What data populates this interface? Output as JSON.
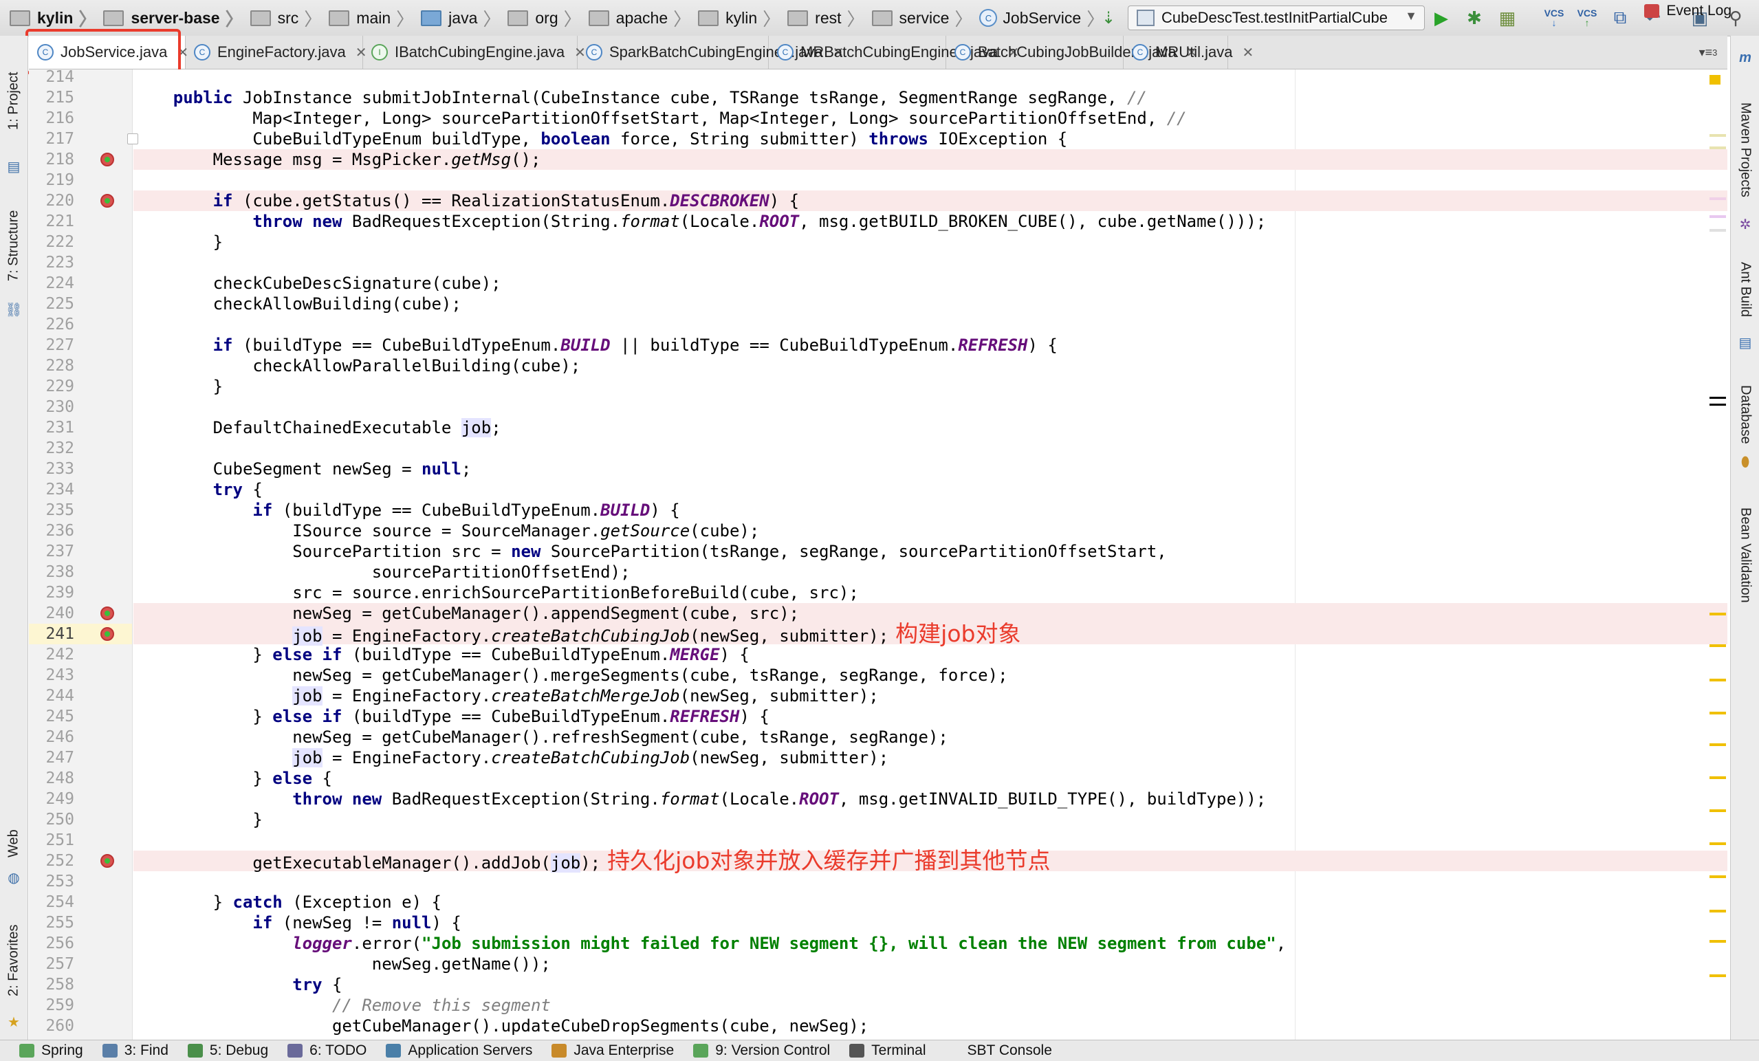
{
  "breadcrumbs": [
    "kylin",
    "server-base",
    "src",
    "main",
    "java",
    "org",
    "apache",
    "kylin",
    "rest",
    "service",
    "JobService"
  ],
  "run_config": "CubeDescTest.testInitPartialCube",
  "toolbar": {
    "vcs1": "VCS",
    "vcs2": "VCS",
    "tab_overflow": "3"
  },
  "tabs": [
    {
      "label": "JobService.java",
      "kind": "C"
    },
    {
      "label": "EngineFactory.java",
      "kind": "C"
    },
    {
      "label": "IBatchCubingEngine.java",
      "kind": "I"
    },
    {
      "label": "SparkBatchCubingEngine2.java",
      "kind": "C"
    },
    {
      "label": "MRBatchCubingEngine2.java",
      "kind": "C"
    },
    {
      "label": "BatchCubingJobBuilder2.java",
      "kind": "C"
    },
    {
      "label": "MRUtil.java",
      "kind": "C"
    }
  ],
  "left_tools": [
    "1: Project",
    "7: Structure",
    "Web",
    "2: Favorites"
  ],
  "right_tools": [
    "Maven Projects",
    "Ant Build",
    "Database",
    "Bean Validation"
  ],
  "bottom_tools": [
    "Spring",
    "3: Find",
    "5: Debug",
    "6: TODO",
    "Application Servers",
    "Java Enterprise",
    "9: Version Control",
    "Terminal",
    "SBT Console"
  ],
  "event_log": "Event Log",
  "annotations": {
    "create_job": "构建job对象",
    "persist_job": "持久化job对象并放入缓存并广播到其他节点"
  },
  "colors": {
    "annotation": "#ea3b2c",
    "keyword": "#000080",
    "string": "#008000",
    "breakpoint_line": "#fae9e9"
  },
  "editor": {
    "first_line": 214,
    "current_line": 241,
    "breakpoint_lines": [
      218,
      220,
      240,
      241,
      252
    ],
    "lines": [
      "",
      "    public JobInstance submitJobInternal(CubeInstance cube, TSRange tsRange, SegmentRange segRange, //",
      "            Map<Integer, Long> sourcePartitionOffsetStart, Map<Integer, Long> sourcePartitionOffsetEnd, //",
      "            CubeBuildTypeEnum buildType, boolean force, String submitter) throws IOException {",
      "        Message msg = MsgPicker.getMsg();",
      "",
      "        if (cube.getStatus() == RealizationStatusEnum.DESCBROKEN) {",
      "            throw new BadRequestException(String.format(Locale.ROOT, msg.getBUILD_BROKEN_CUBE(), cube.getName()));",
      "        }",
      "",
      "        checkCubeDescSignature(cube);",
      "        checkAllowBuilding(cube);",
      "",
      "        if (buildType == CubeBuildTypeEnum.BUILD || buildType == CubeBuildTypeEnum.REFRESH) {",
      "            checkAllowParallelBuilding(cube);",
      "        }",
      "",
      "        DefaultChainedExecutable job;",
      "",
      "        CubeSegment newSeg = null;",
      "        try {",
      "            if (buildType == CubeBuildTypeEnum.BUILD) {",
      "                ISource source = SourceManager.getSource(cube);",
      "                SourcePartition src = new SourcePartition(tsRange, segRange, sourcePartitionOffsetStart,",
      "                        sourcePartitionOffsetEnd);",
      "                src = source.enrichSourcePartitionBeforeBuild(cube, src);",
      "                newSeg = getCubeManager().appendSegment(cube, src);",
      "                job = EngineFactory.createBatchCubingJob(newSeg, submitter);",
      "            } else if (buildType == CubeBuildTypeEnum.MERGE) {",
      "                newSeg = getCubeManager().mergeSegments(cube, tsRange, segRange, force);",
      "                job = EngineFactory.createBatchMergeJob(newSeg, submitter);",
      "            } else if (buildType == CubeBuildTypeEnum.REFRESH) {",
      "                newSeg = getCubeManager().refreshSegment(cube, tsRange, segRange);",
      "                job = EngineFactory.createBatchCubingJob(newSeg, submitter);",
      "            } else {",
      "                throw new BadRequestException(String.format(Locale.ROOT, msg.getINVALID_BUILD_TYPE(), buildType));",
      "            }",
      "",
      "            getExecutableManager().addJob(job);",
      "",
      "        } catch (Exception e) {",
      "            if (newSeg != null) {",
      "                logger.error(\"Job submission might failed for NEW segment {}, will clean the NEW segment from cube\",",
      "                        newSeg.getName());",
      "                try {",
      "                    // Remove this segment",
      "                    getCubeManager().updateCubeDropSegments(cube, newSeg);"
    ]
  }
}
